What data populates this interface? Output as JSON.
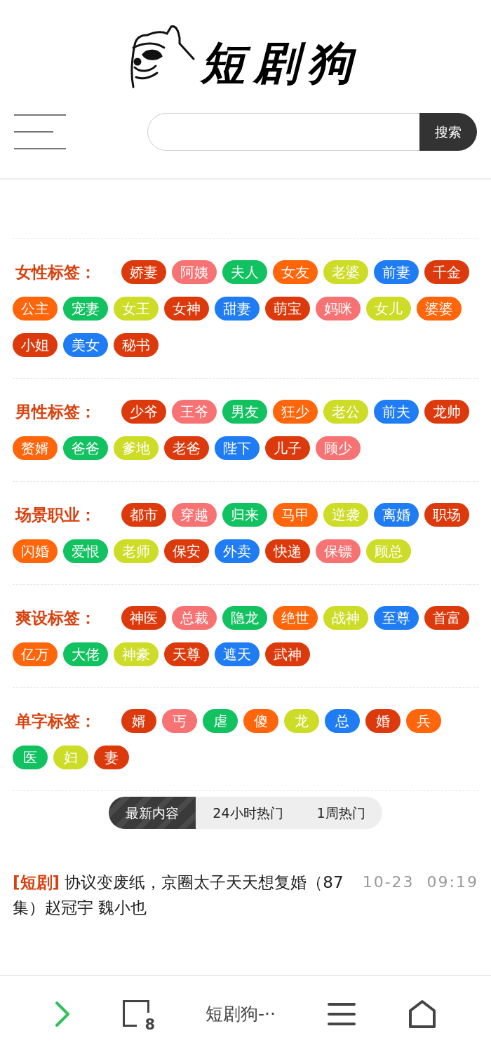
{
  "logo": {
    "text": "短剧狗"
  },
  "search": {
    "button": "搜索"
  },
  "sections": [
    {
      "label": "女性标签：",
      "tags": [
        {
          "text": "娇妻",
          "color": "#dc3a0c"
        },
        {
          "text": "阿姨",
          "color": "#f77373"
        },
        {
          "text": "夫人",
          "color": "#12c160"
        },
        {
          "text": "女友",
          "color": "#ff650a"
        },
        {
          "text": "老婆",
          "color": "#cddc27"
        },
        {
          "text": "前妻",
          "color": "#1f7cf2"
        },
        {
          "text": "千金",
          "color": "#dc3a0c"
        },
        {
          "text": "公主",
          "color": "#ff650a"
        },
        {
          "text": "宠妻",
          "color": "#12c160"
        },
        {
          "text": "女王",
          "color": "#cddc27"
        },
        {
          "text": "女神",
          "color": "#dc3a0c"
        },
        {
          "text": "甜妻",
          "color": "#1f7cf2"
        },
        {
          "text": "萌宝",
          "color": "#dc3a0c"
        },
        {
          "text": "妈咪",
          "color": "#f77373"
        },
        {
          "text": "女儿",
          "color": "#cddc27"
        },
        {
          "text": "婆婆",
          "color": "#ff650a"
        },
        {
          "text": "小姐",
          "color": "#dc3a0c"
        },
        {
          "text": "美女",
          "color": "#1f7cf2"
        },
        {
          "text": "秘书",
          "color": "#dc3a0c"
        }
      ]
    },
    {
      "label": "男性标签：",
      "tags": [
        {
          "text": "少爷",
          "color": "#dc3a0c"
        },
        {
          "text": "王爷",
          "color": "#f77373"
        },
        {
          "text": "男友",
          "color": "#12c160"
        },
        {
          "text": "狂少",
          "color": "#ff650a"
        },
        {
          "text": "老公",
          "color": "#cddc27"
        },
        {
          "text": "前夫",
          "color": "#1f7cf2"
        },
        {
          "text": "龙帅",
          "color": "#dc3a0c"
        },
        {
          "text": "赘婿",
          "color": "#ff650a"
        },
        {
          "text": "爸爸",
          "color": "#12c160"
        },
        {
          "text": "爹地",
          "color": "#cddc27"
        },
        {
          "text": "老爸",
          "color": "#dc3a0c"
        },
        {
          "text": "陛下",
          "color": "#1f7cf2"
        },
        {
          "text": "儿子",
          "color": "#dc3a0c"
        },
        {
          "text": "顾少",
          "color": "#f77373"
        }
      ]
    },
    {
      "label": "场景职业：",
      "tags": [
        {
          "text": "都市",
          "color": "#dc3a0c"
        },
        {
          "text": "穿越",
          "color": "#f77373"
        },
        {
          "text": "归来",
          "color": "#12c160"
        },
        {
          "text": "马甲",
          "color": "#ff650a"
        },
        {
          "text": "逆袭",
          "color": "#cddc27"
        },
        {
          "text": "离婚",
          "color": "#1f7cf2"
        },
        {
          "text": "职场",
          "color": "#dc3a0c"
        },
        {
          "text": "闪婚",
          "color": "#ff650a"
        },
        {
          "text": "爱恨",
          "color": "#12c160"
        },
        {
          "text": "老师",
          "color": "#cddc27"
        },
        {
          "text": "保安",
          "color": "#dc3a0c"
        },
        {
          "text": "外卖",
          "color": "#1f7cf2"
        },
        {
          "text": "快递",
          "color": "#dc3a0c"
        },
        {
          "text": "保镖",
          "color": "#f77373"
        },
        {
          "text": "顾总",
          "color": "#cddc27"
        }
      ]
    },
    {
      "label": "爽设标签：",
      "tags": [
        {
          "text": "神医",
          "color": "#dc3a0c"
        },
        {
          "text": "总裁",
          "color": "#f77373"
        },
        {
          "text": "隐龙",
          "color": "#12c160"
        },
        {
          "text": "绝世",
          "color": "#ff650a"
        },
        {
          "text": "战神",
          "color": "#cddc27"
        },
        {
          "text": "至尊",
          "color": "#1f7cf2"
        },
        {
          "text": "首富",
          "color": "#dc3a0c"
        },
        {
          "text": "亿万",
          "color": "#ff650a"
        },
        {
          "text": "大佬",
          "color": "#12c160"
        },
        {
          "text": "神豪",
          "color": "#cddc27"
        },
        {
          "text": "天尊",
          "color": "#dc3a0c"
        },
        {
          "text": "遮天",
          "color": "#1f7cf2"
        },
        {
          "text": "武神",
          "color": "#dc3a0c"
        }
      ]
    },
    {
      "label": "单字标签：",
      "tags": [
        {
          "text": "婿",
          "color": "#dc3a0c"
        },
        {
          "text": "丐",
          "color": "#f77373"
        },
        {
          "text": "虐",
          "color": "#12c160"
        },
        {
          "text": "傻",
          "color": "#ff650a"
        },
        {
          "text": "龙",
          "color": "#cddc27"
        },
        {
          "text": "总",
          "color": "#1f7cf2"
        },
        {
          "text": "婚",
          "color": "#dc3a0c"
        },
        {
          "text": "兵",
          "color": "#ff650a"
        },
        {
          "text": "医",
          "color": "#12c160"
        },
        {
          "text": "妇",
          "color": "#cddc27"
        },
        {
          "text": "妻",
          "color": "#dc3a0c"
        }
      ]
    }
  ],
  "tabs": [
    {
      "label": "最新内容",
      "selected": true
    },
    {
      "label": "24小时热门",
      "selected": false
    },
    {
      "label": "1周热门",
      "selected": false
    }
  ],
  "articles": [
    {
      "category": "[短剧]",
      "title": "协议变废纸，京圈太子天天想复婚（87集）赵冠宇 魏小也",
      "time": "10-23  09:19"
    }
  ],
  "browser_bar": {
    "tab_count": "8",
    "page_title": "短剧狗-··"
  }
}
